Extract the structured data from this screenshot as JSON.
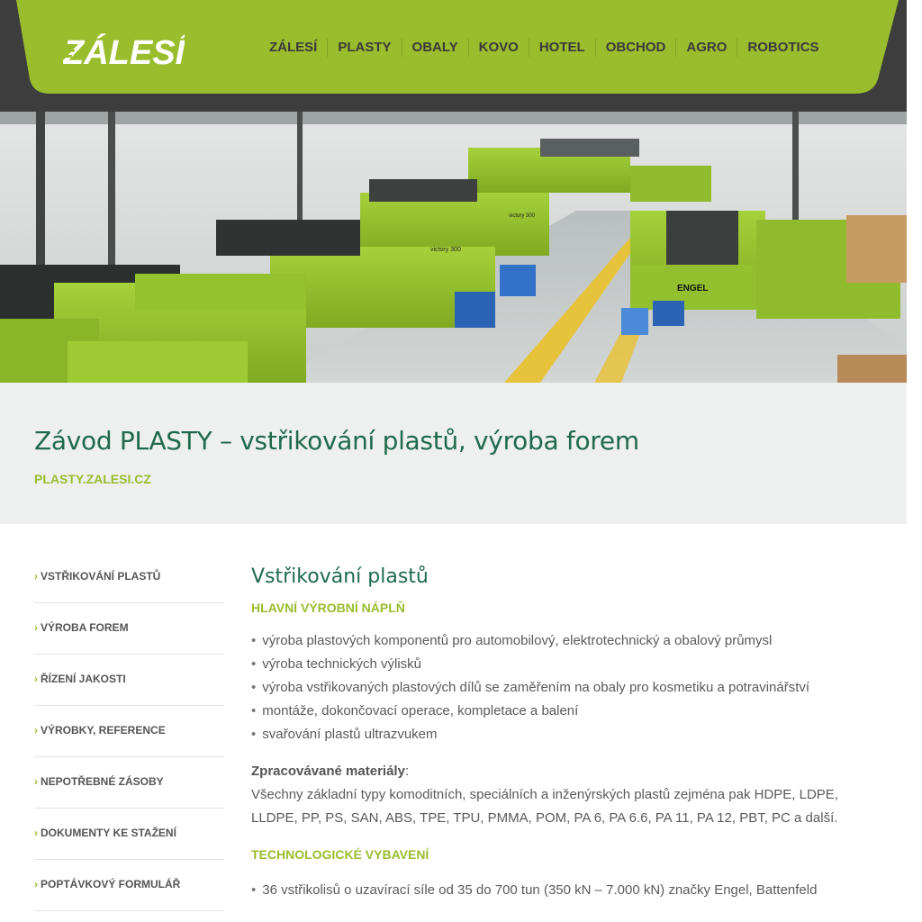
{
  "brand": {
    "logo_text": "ZÁLESÍ",
    "accent_color": "#99bd2d",
    "header_dark": "#3d3d3d",
    "title_color": "#1f6a4d"
  },
  "nav": {
    "items": [
      "ZÁLESÍ",
      "PLASTY",
      "OBALY",
      "KOVO",
      "HOTEL",
      "OBCHOD",
      "AGRO",
      "ROBOTICS"
    ]
  },
  "hero": {
    "image": "factory-injection-molding-hall",
    "machine_labels": [
      "ENGEL",
      "victory 300",
      "victory 300"
    ]
  },
  "title_band": {
    "title": "Závod PLASTY – vstřikování plastů, výroba forem",
    "link": "PLASTY.ZALESI.CZ"
  },
  "sidebar": {
    "chevron": "›",
    "items": [
      "VSTŘIKOVÁNÍ PLASTŮ",
      "VÝROBA FOREM",
      "ŘÍZENÍ JAKOSTI",
      "VÝROBKY, REFERENCE",
      "NEPOTŘEBNÉ ZÁSOBY",
      "DOKUMENTY KE STAŽENÍ",
      "POPTÁVKOVÝ FORMULÁŘ"
    ]
  },
  "main": {
    "title": "Vstřikování plastů",
    "section1_heading": "HLAVNÍ VÝROBNÍ NÁPLŇ",
    "section1_bullets": [
      "výroba plastových komponentů pro automobilový, elektrotechnický a obalový průmysl",
      "výroba technických výlisků",
      "výroba vstřikovaných plastových dílů se zaměřením na obaly pro kosmetiku a potravinářství",
      "montáže, dokončovací operace, kompletace a balení",
      "svařování plastů ultrazvukem"
    ],
    "materials_label": "Zpracovávané materiály",
    "materials_colon": ":",
    "materials_text": "Všechny základní typy komoditních, speciálních a inženýrských plastů zejména pak HDPE, LDPE, LLDPE, PP, PS, SAN, ABS, TPE, TPU, PMMA, POM, PA 6, PA 6.6, PA 11, PA 12, PBT, PC a další.",
    "section2_heading": "TECHNOLOGICKÉ VYBAVENÍ",
    "section2_bullets": [
      "36 vstřikolisů o uzavírací síle od 35 do 700 tun (350 kN – 7.000 kN) značky Engel, Battenfeld"
    ]
  }
}
